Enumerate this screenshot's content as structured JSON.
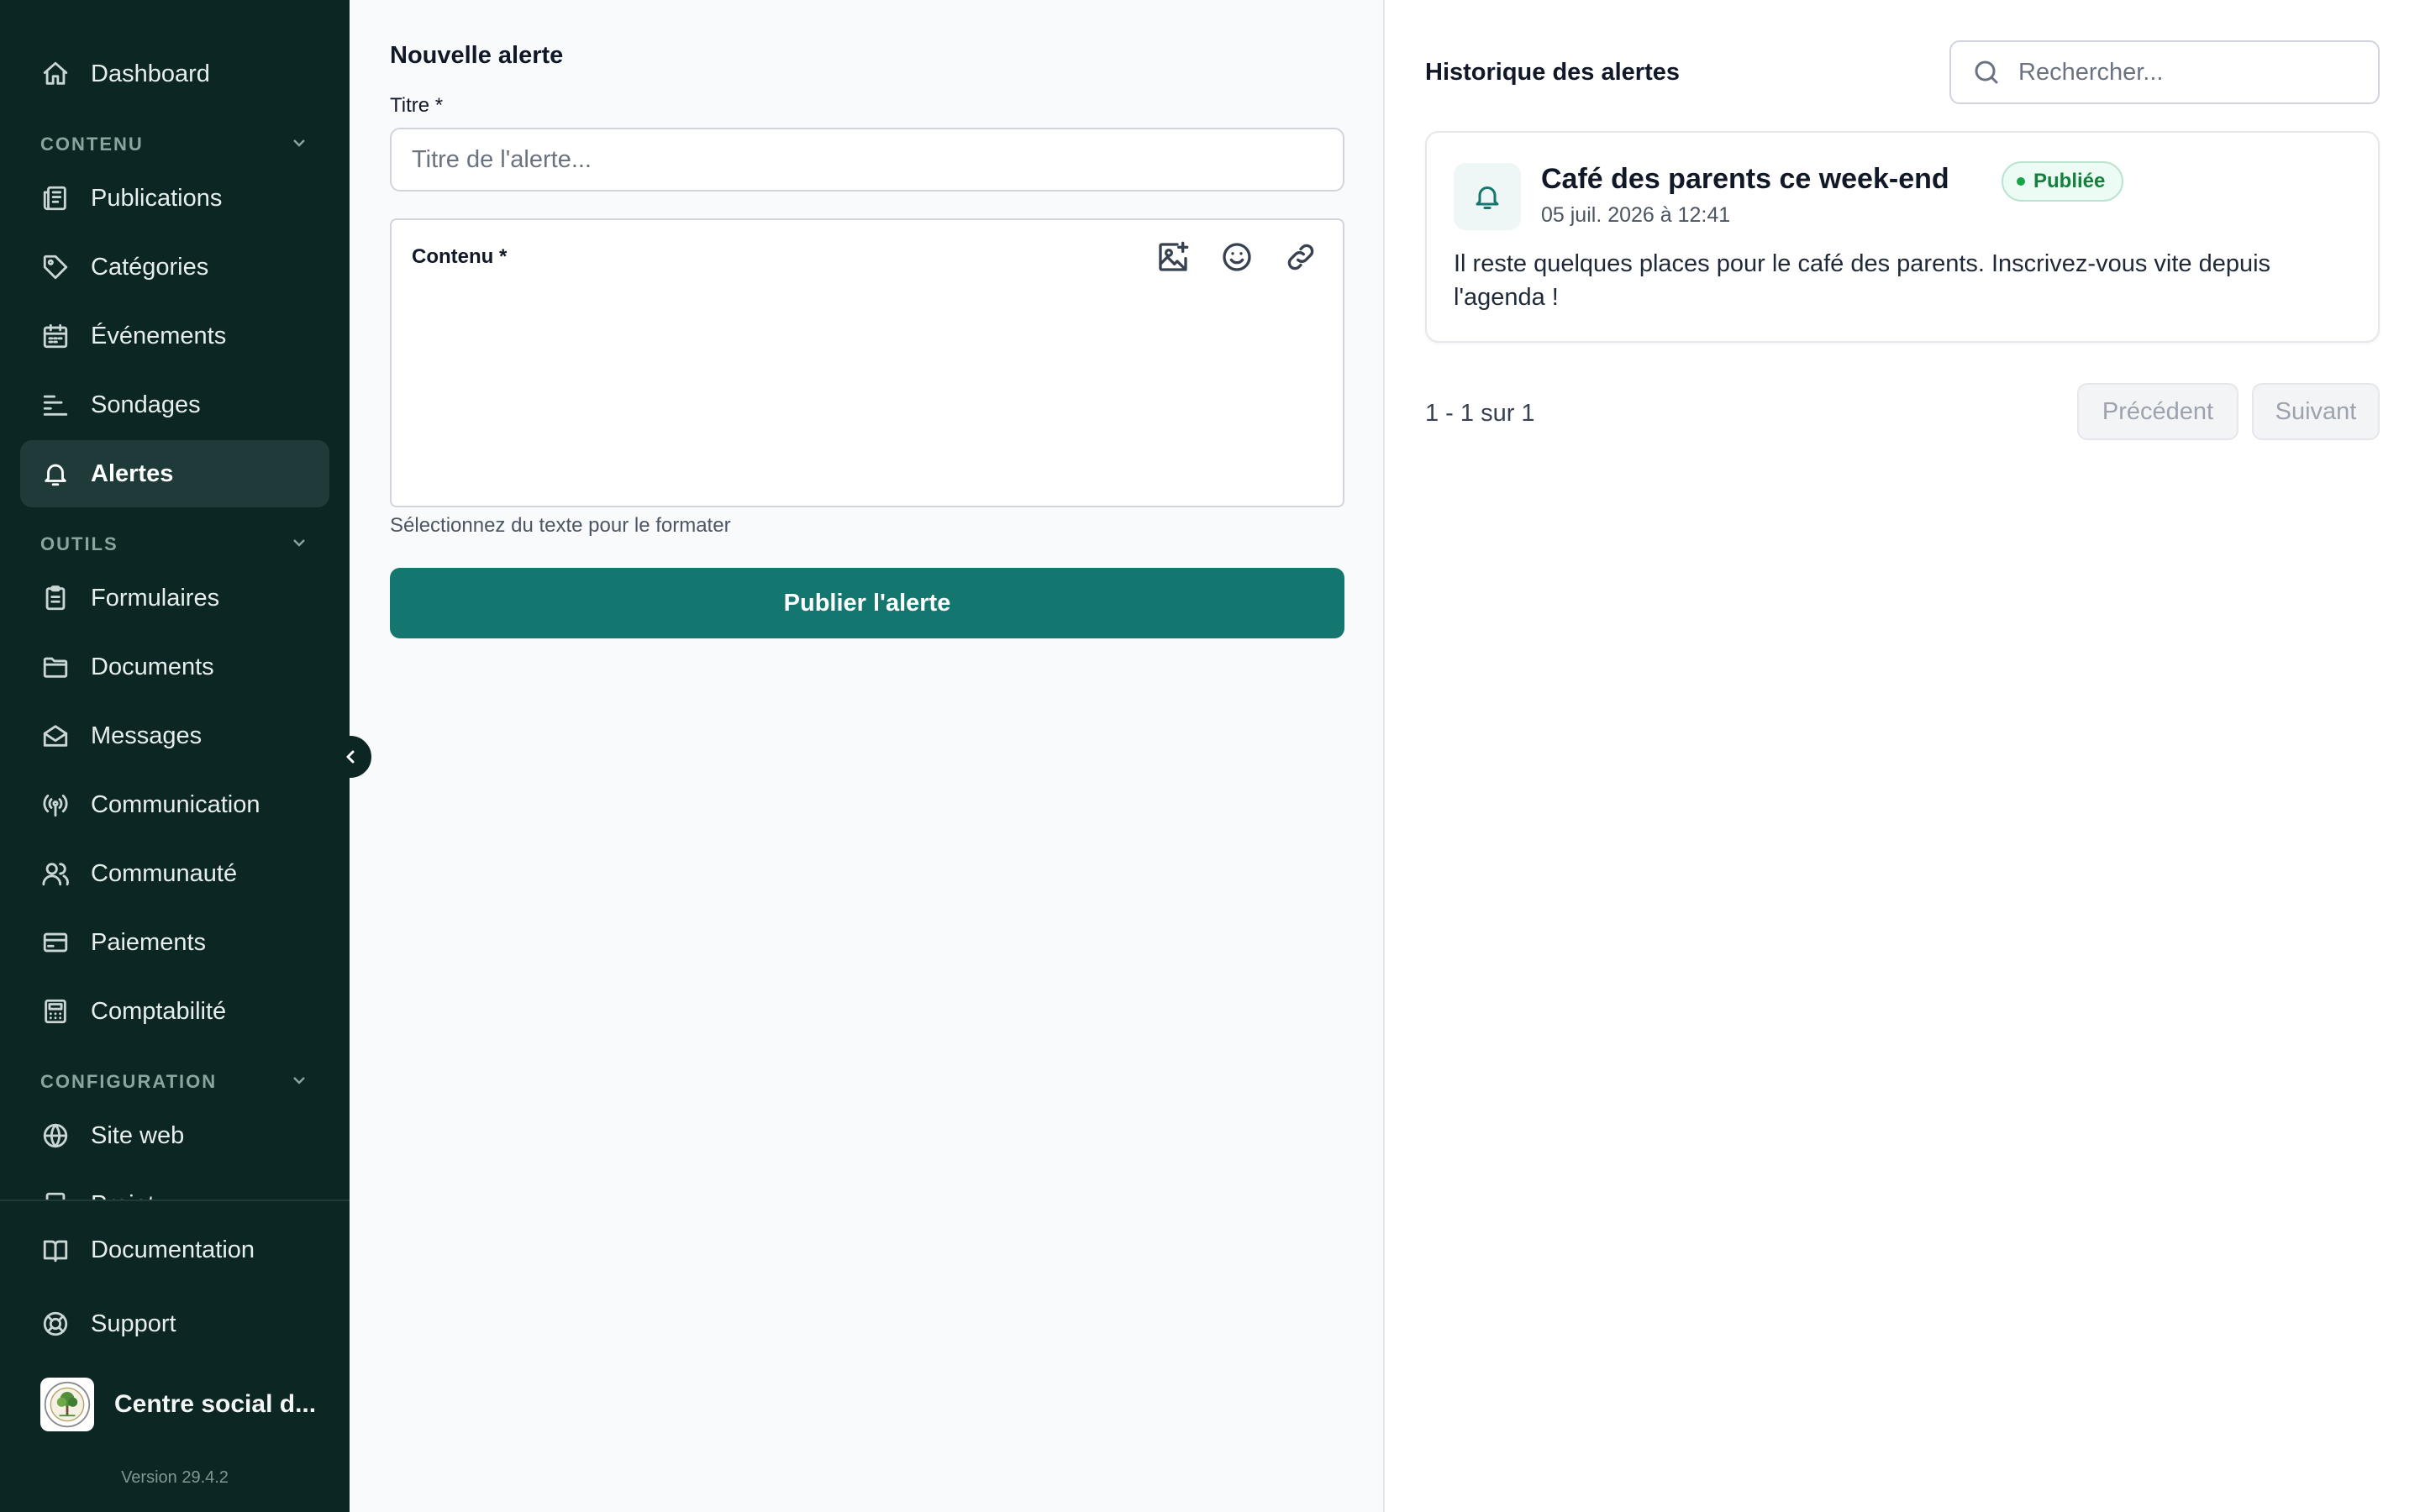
{
  "sidebar": {
    "items": [
      {
        "label": "Dashboard",
        "icon": "home-icon"
      },
      {
        "label": "Publications",
        "icon": "newspaper-icon"
      },
      {
        "label": "Catégories",
        "icon": "tag-icon"
      },
      {
        "label": "Événements",
        "icon": "calendar-icon"
      },
      {
        "label": "Sondages",
        "icon": "poll-icon"
      },
      {
        "label": "Alertes",
        "icon": "bell-icon",
        "active": true
      },
      {
        "label": "Formulaires",
        "icon": "clipboard-icon"
      },
      {
        "label": "Documents",
        "icon": "folder-icon"
      },
      {
        "label": "Messages",
        "icon": "mail-open-icon"
      },
      {
        "label": "Communication",
        "icon": "broadcast-icon"
      },
      {
        "label": "Communauté",
        "icon": "users-icon"
      },
      {
        "label": "Paiements",
        "icon": "credit-card-icon"
      },
      {
        "label": "Comptabilité",
        "icon": "calculator-icon"
      },
      {
        "label": "Site web",
        "icon": "globe-icon"
      },
      {
        "label": "Projet",
        "icon": "file-icon"
      }
    ],
    "sections": {
      "contenu": "CONTENU",
      "outils": "OUTILS",
      "configuration": "CONFIGURATION"
    },
    "bottom": {
      "documentation": "Documentation",
      "support": "Support"
    },
    "org_name": "Centre social d...",
    "version": "Version 29.4.2"
  },
  "form": {
    "heading": "Nouvelle alerte",
    "title_label": "Titre *",
    "title_placeholder": "Titre de l'alerte...",
    "content_label": "Contenu *",
    "hint": "Sélectionnez du texte pour le formater",
    "publish_label": "Publier l'alerte"
  },
  "history": {
    "heading": "Historique des alertes",
    "search_placeholder": "Rechercher...",
    "alerts": [
      {
        "title": "Café des parents ce week-end",
        "status": "Publiée",
        "date": "05 juil. 2026 à 12:41",
        "body": "Il reste quelques places pour le café des parents. Inscrivez-vous vite depuis l'agenda !"
      }
    ],
    "pagination": {
      "info": "1 - 1 sur 1",
      "prev": "Précédent",
      "next": "Suivant"
    }
  },
  "colors": {
    "sidebar_bg": "#0c2624",
    "accent": "#13776f",
    "status_green": "#15803d"
  }
}
